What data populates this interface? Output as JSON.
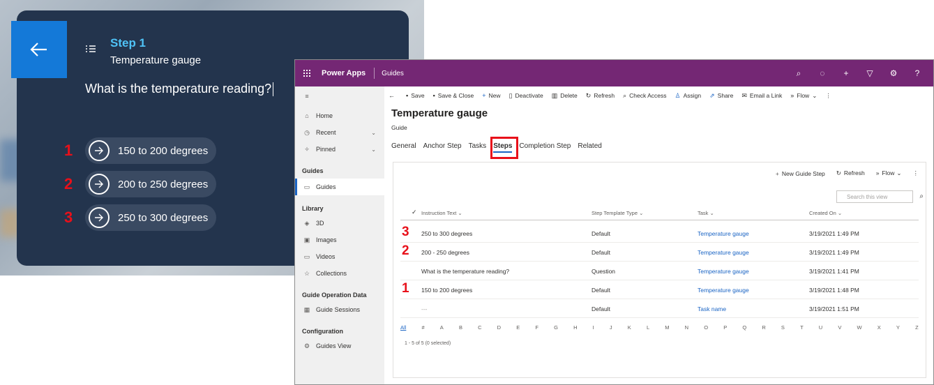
{
  "holo": {
    "step_title": "Step 1",
    "step_subtitle": "Temperature gauge",
    "question": "What is the temperature reading?",
    "choices": [
      {
        "number": "1",
        "label": "150 to 200 degrees"
      },
      {
        "number": "2",
        "label": "200 to 250 degrees"
      },
      {
        "number": "3",
        "label": "250 to 300 degrees"
      }
    ]
  },
  "powerapps": {
    "brand": "Power Apps",
    "app_name": "Guides",
    "nav": {
      "items_top": [
        "Home",
        "Recent",
        "Pinned"
      ],
      "section_guides": "Guides",
      "guides_item": "Guides",
      "section_library": "Library",
      "library_items": [
        "3D",
        "Images",
        "Videos",
        "Collections"
      ],
      "section_data": "Guide Operation Data",
      "data_item": "Guide Sessions",
      "section_config": "Configuration",
      "config_item": "Guides View"
    },
    "commands": [
      "Save",
      "Save & Close",
      "New",
      "Deactivate",
      "Delete",
      "Refresh",
      "Check Access",
      "Assign",
      "Share",
      "Email a Link",
      "Flow"
    ],
    "form_title": "Temperature gauge",
    "form_subtitle": "Guide",
    "tabs": [
      "General",
      "Anchor Step",
      "Tasks",
      "Steps",
      "Completion Step",
      "Related"
    ],
    "grid": {
      "new_step": "New Guide Step",
      "refresh": "Refresh",
      "flow": "Flow",
      "search_placeholder": "Search this view",
      "columns": [
        "Instruction Text",
        "Step Template Type",
        "Task",
        "Created On"
      ],
      "rows": [
        {
          "marker": "3",
          "text": "250 to 300 degrees",
          "type": "Default",
          "task": "Temperature gauge",
          "created": "3/19/2021 1:49 PM"
        },
        {
          "marker": "2",
          "text": "200 - 250 degrees",
          "type": "Default",
          "task": "Temperature gauge",
          "created": "3/19/2021 1:49 PM"
        },
        {
          "marker": "",
          "text": "What is the temperature reading?",
          "type": "Question",
          "task": "Temperature gauge",
          "created": "3/19/2021 1:41 PM"
        },
        {
          "marker": "1",
          "text": "150 to 200 degrees",
          "type": "Default",
          "task": "Temperature gauge",
          "created": "3/19/2021 1:48 PM"
        },
        {
          "marker": "",
          "text": "---",
          "type": "Default",
          "task": "Task name",
          "created": "3/19/2021 1:51 PM"
        }
      ],
      "alphabet": [
        "All",
        "#",
        "A",
        "B",
        "C",
        "D",
        "E",
        "F",
        "G",
        "H",
        "I",
        "J",
        "K",
        "L",
        "M",
        "N",
        "O",
        "P",
        "Q",
        "R",
        "S",
        "T",
        "U",
        "V",
        "W",
        "X",
        "Y",
        "Z"
      ],
      "footer": "1 - 5 of 5 (0 selected)"
    }
  },
  "colors": {
    "card_bg": "#23344d",
    "accent_blue": "#1479d8",
    "step_title": "#4fc3f7",
    "annotation_red": "#e8101a",
    "powerapps_bar": "#742774"
  }
}
